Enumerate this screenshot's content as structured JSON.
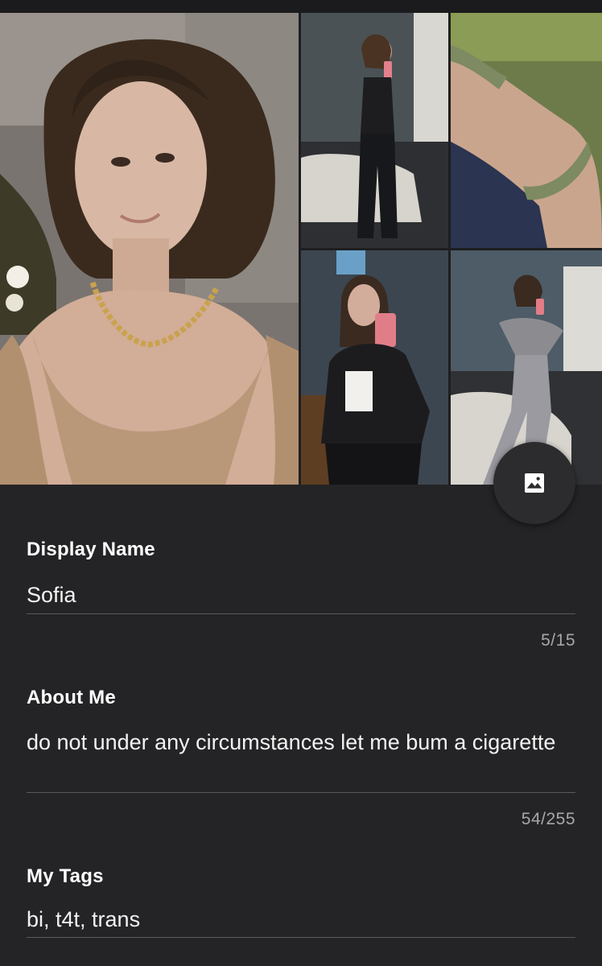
{
  "gallery": {
    "photos": [
      {
        "name": "profile-photo-main"
      },
      {
        "name": "profile-photo-2"
      },
      {
        "name": "profile-photo-3"
      },
      {
        "name": "profile-photo-4"
      },
      {
        "name": "profile-photo-5"
      }
    ],
    "fab_icon": "image-icon"
  },
  "fields": {
    "display_name": {
      "label": "Display Name",
      "value": "Sofia",
      "counter": "5/15"
    },
    "about_me": {
      "label": "About Me",
      "value": "do not under any circumstances let me bum a cigarette",
      "counter": "54/255"
    },
    "tags": {
      "label": "My Tags",
      "value": "bi, t4t, trans"
    }
  },
  "colors": {
    "background": "#242426",
    "fab": "#2c2c2e",
    "underline": "#5a5a5e",
    "counter_text": "#a7a7ab"
  }
}
